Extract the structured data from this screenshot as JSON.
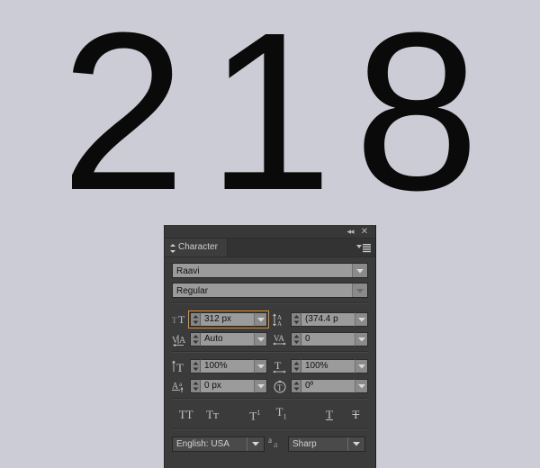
{
  "canvas": {
    "text": "218",
    "background_color": "#ccccd6",
    "text_color": "#0a0a0a"
  },
  "panel": {
    "titlebar": {
      "collapse_icon": "double-left-chevron",
      "collapse_glyph": "◂◂",
      "close_icon": "close-x",
      "close_glyph": "✕"
    },
    "tab": {
      "label": "Character",
      "diamond_icon": "diamond-toggle",
      "menu_icon": "panel-menu"
    },
    "font_family": {
      "label": "Font Family",
      "value": "Raavi"
    },
    "font_style": {
      "label": "Font Style",
      "value": "Regular"
    },
    "metrics": [
      {
        "icon_name": "font-size-icon",
        "label": "Font Size",
        "value": "312 px",
        "highlighted": true
      },
      {
        "icon_name": "leading-icon",
        "label": "Leading",
        "value": "(374.4 p",
        "highlighted": false
      },
      {
        "icon_name": "kerning-icon",
        "label": "Kerning",
        "value": "Auto",
        "highlighted": false
      },
      {
        "icon_name": "tracking-icon",
        "label": "Tracking",
        "value": "0",
        "highlighted": false
      },
      {
        "icon_name": "vertical-scale-icon",
        "label": "Vertical Scale",
        "value": "100%",
        "highlighted": false
      },
      {
        "icon_name": "horizontal-scale-icon",
        "label": "Horizontal Scale",
        "value": "100%",
        "highlighted": false
      },
      {
        "icon_name": "baseline-shift-icon",
        "label": "Baseline Shift",
        "value": "0 px",
        "highlighted": false
      },
      {
        "icon_name": "text-rotation-icon",
        "label": "Character Rotation",
        "value": "0º",
        "highlighted": false
      }
    ],
    "style_buttons": [
      {
        "name": "faux-bold-button",
        "label": "TT",
        "kind": "allcaps"
      },
      {
        "name": "faux-italic-button",
        "label": "Tᴛ",
        "kind": "smallcaps"
      },
      {
        "name": "superscript-button",
        "label": "T",
        "sup": "1",
        "kind": "superscript"
      },
      {
        "name": "subscript-button",
        "label": "T",
        "sub": "1",
        "kind": "subscript"
      },
      {
        "name": "underline-button",
        "label": "T",
        "kind": "underline"
      },
      {
        "name": "strikethrough-button",
        "label": "T",
        "kind": "strikethrough"
      }
    ],
    "language": {
      "label": "Language",
      "value": "English: USA"
    },
    "anti_alias": {
      "icon_name": "anti-alias-icon",
      "icon_glyph": "a",
      "label": "Anti-aliasing",
      "value": "Sharp"
    },
    "colors": {
      "panel_bg": "#3b3b3b",
      "field_bg": "#9b9b9b",
      "highlight": "#e08a24",
      "text": "#c8c8c8"
    }
  }
}
